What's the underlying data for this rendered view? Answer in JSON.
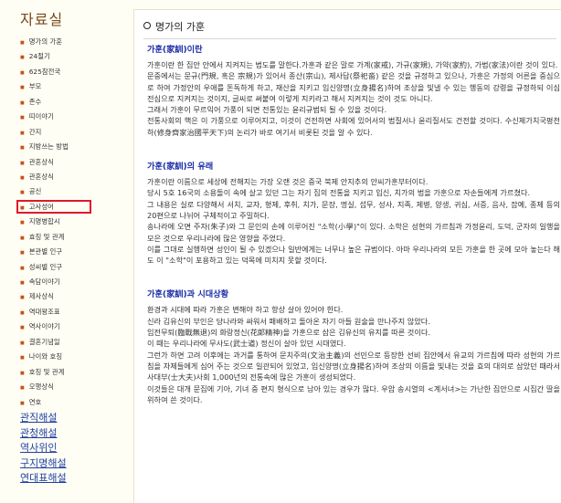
{
  "sidebar": {
    "title": "자료실",
    "menu": [
      "명가의 가훈",
      "24절기",
      "625참전국",
      "부모",
      "존수",
      "띠이야기",
      "간지",
      "지방쓰는 방법",
      "관혼상식",
      "관혼상식",
      "공신",
      "고사성어",
      "지명병합시",
      "효칭 및 관계",
      "본관별 인구",
      "성씨별 인구",
      "속담이야기",
      "제사상식",
      "역대왕조표",
      "역사이야기",
      "결혼기념일",
      "나이와 호칭",
      "호칭 및 관계",
      "오행상식",
      "연호"
    ],
    "selected_index": 11,
    "links": [
      "관직해설",
      "관청해설",
      "역사위인",
      "구지명해설",
      "연대표해설"
    ]
  },
  "panel": {
    "heading": "명가의 가훈",
    "sections": [
      {
        "title": "가훈(家訓)이란",
        "paragraphs": [
          "가훈이란 한 집안 안에서 지켜지는 법도를 말한다.가훈과 같은 말로 가계(家戒), 가규(家規), 가약(家約), 가법(家法)이란 것이 있다.",
          "문중에서는 문규(門規, 혹은 宗規)가 있어서 종산(宗山), 제사답(祭祀畓) 같은 것을 규정하고 있으나, 가훈은 가정의 어른을 중심으로 하여 가정안의 우애를 돈독하게 하고, 재산을 지키고 입신양명(立身揚名)하여 조상을 빛낼 수 있는 행동의 강령을 규정하되 이심전심으로 지켜지는 것이지, 글씨로 써붙여 이렇게 지키라고 해서 지켜지는 것이 것도 아니다.",
          "그래서 가훈이 무르익어 가풍이 되면 전통있는 윤리규범되 될 수 있을 것이다.",
          "전통사회의 핵은 이 가풍으로 이루어지고, 이것이 건전하면 사회에 있어서의 법질서나 윤리질서도 건전할 것이다. 수신제가치국평천하(修身齊家治國平天下)의 논리가 바로 여기서 비롯된 것을 알 수 있다."
        ]
      },
      {
        "title": "가훈(家訓)의 유래",
        "paragraphs": [
          "가훈이란 이름으로 세상에 전해지는 가장 오랜 것은 중국 북제 안지추의 안씨가훈부터이다.",
          "당시 5호 16국의 소용돌이 속에 살고 있던 그는 자기 집의 전통을 지키고 입신, 치가의 법을 가훈으로 자손들에게 가르쳤다.",
          "그 내용은 실로 다양해서 서치, 교자, 형제, 후취, 치가, 문장, 명실, 섭무, 성사, 지족, 제병, 양생, 귀심, 서증, 음사, 잡예, 종제 등의 20편으로 나뉘어 구체적이고 주밀하다.",
          "송나라에 오면 주자(朱子)와 그 문인의 손에 이루어진 \"소학(小學)\"이 있다. 소학은 성현의 가르침과 가정윤리, 도덕, 군자의 일행을 모은 것으로 우리나라에 많은 영향을 주었다.",
          "이를 그대로 실행하면 성인이 될 수 있겠으나 일반에게는 너무나 높은 규범이다. 아마 우리나라의 모든 가훈을 한 곳에 모아 놓는다 해도 이 \"소학\"이 포용하고 있는 덕목에 미치지 못할 것이다."
        ]
      },
      {
        "title": "가훈(家訓)과 시대상황",
        "paragraphs": [
          "환경과 시대에 따라 가훈은 변해야 하고 항상 살아 있어야 한다.",
          "신라 김유신의 부인은 당나라와 싸워서 패배하고 돌아온 자기 아들 원술을 만나주지 않았다.",
          "임전무퇴(臨戰無退)의 화랑정신(花郞精神)을 가훈으로 삼은 김유신의 유지를 따른 것이다.",
          "이 때는 우리나라에 무사도(武士道) 정신이 살아 있던 시대였다.",
          "그런가 하면 고려 이후에는 과거를 통하여 문치주의(文治主義)의 선민으로 등장한 선비 집안에서 유교의 가르침에 따라 성현의 가르침을 자제들에게 심어 주는 것으로 일관되어 있었고, 입신양명(立身揚名)하여 조상의 이름을 빛내는 것을 효의 대의로 삼았던 때라서 사대부(士大夫)사회 1,000년의 전통속에 많은 가훈이 생성되었다.",
          "이것들은 대개 문집에 기아, 기녀 중 편지 형식으로 남아 있는 경우가 많다. 우암 송시열의 <계서녀>는 가난한 집안으로 시집간 딸을 위하여 쓴 것이다."
        ]
      }
    ]
  }
}
